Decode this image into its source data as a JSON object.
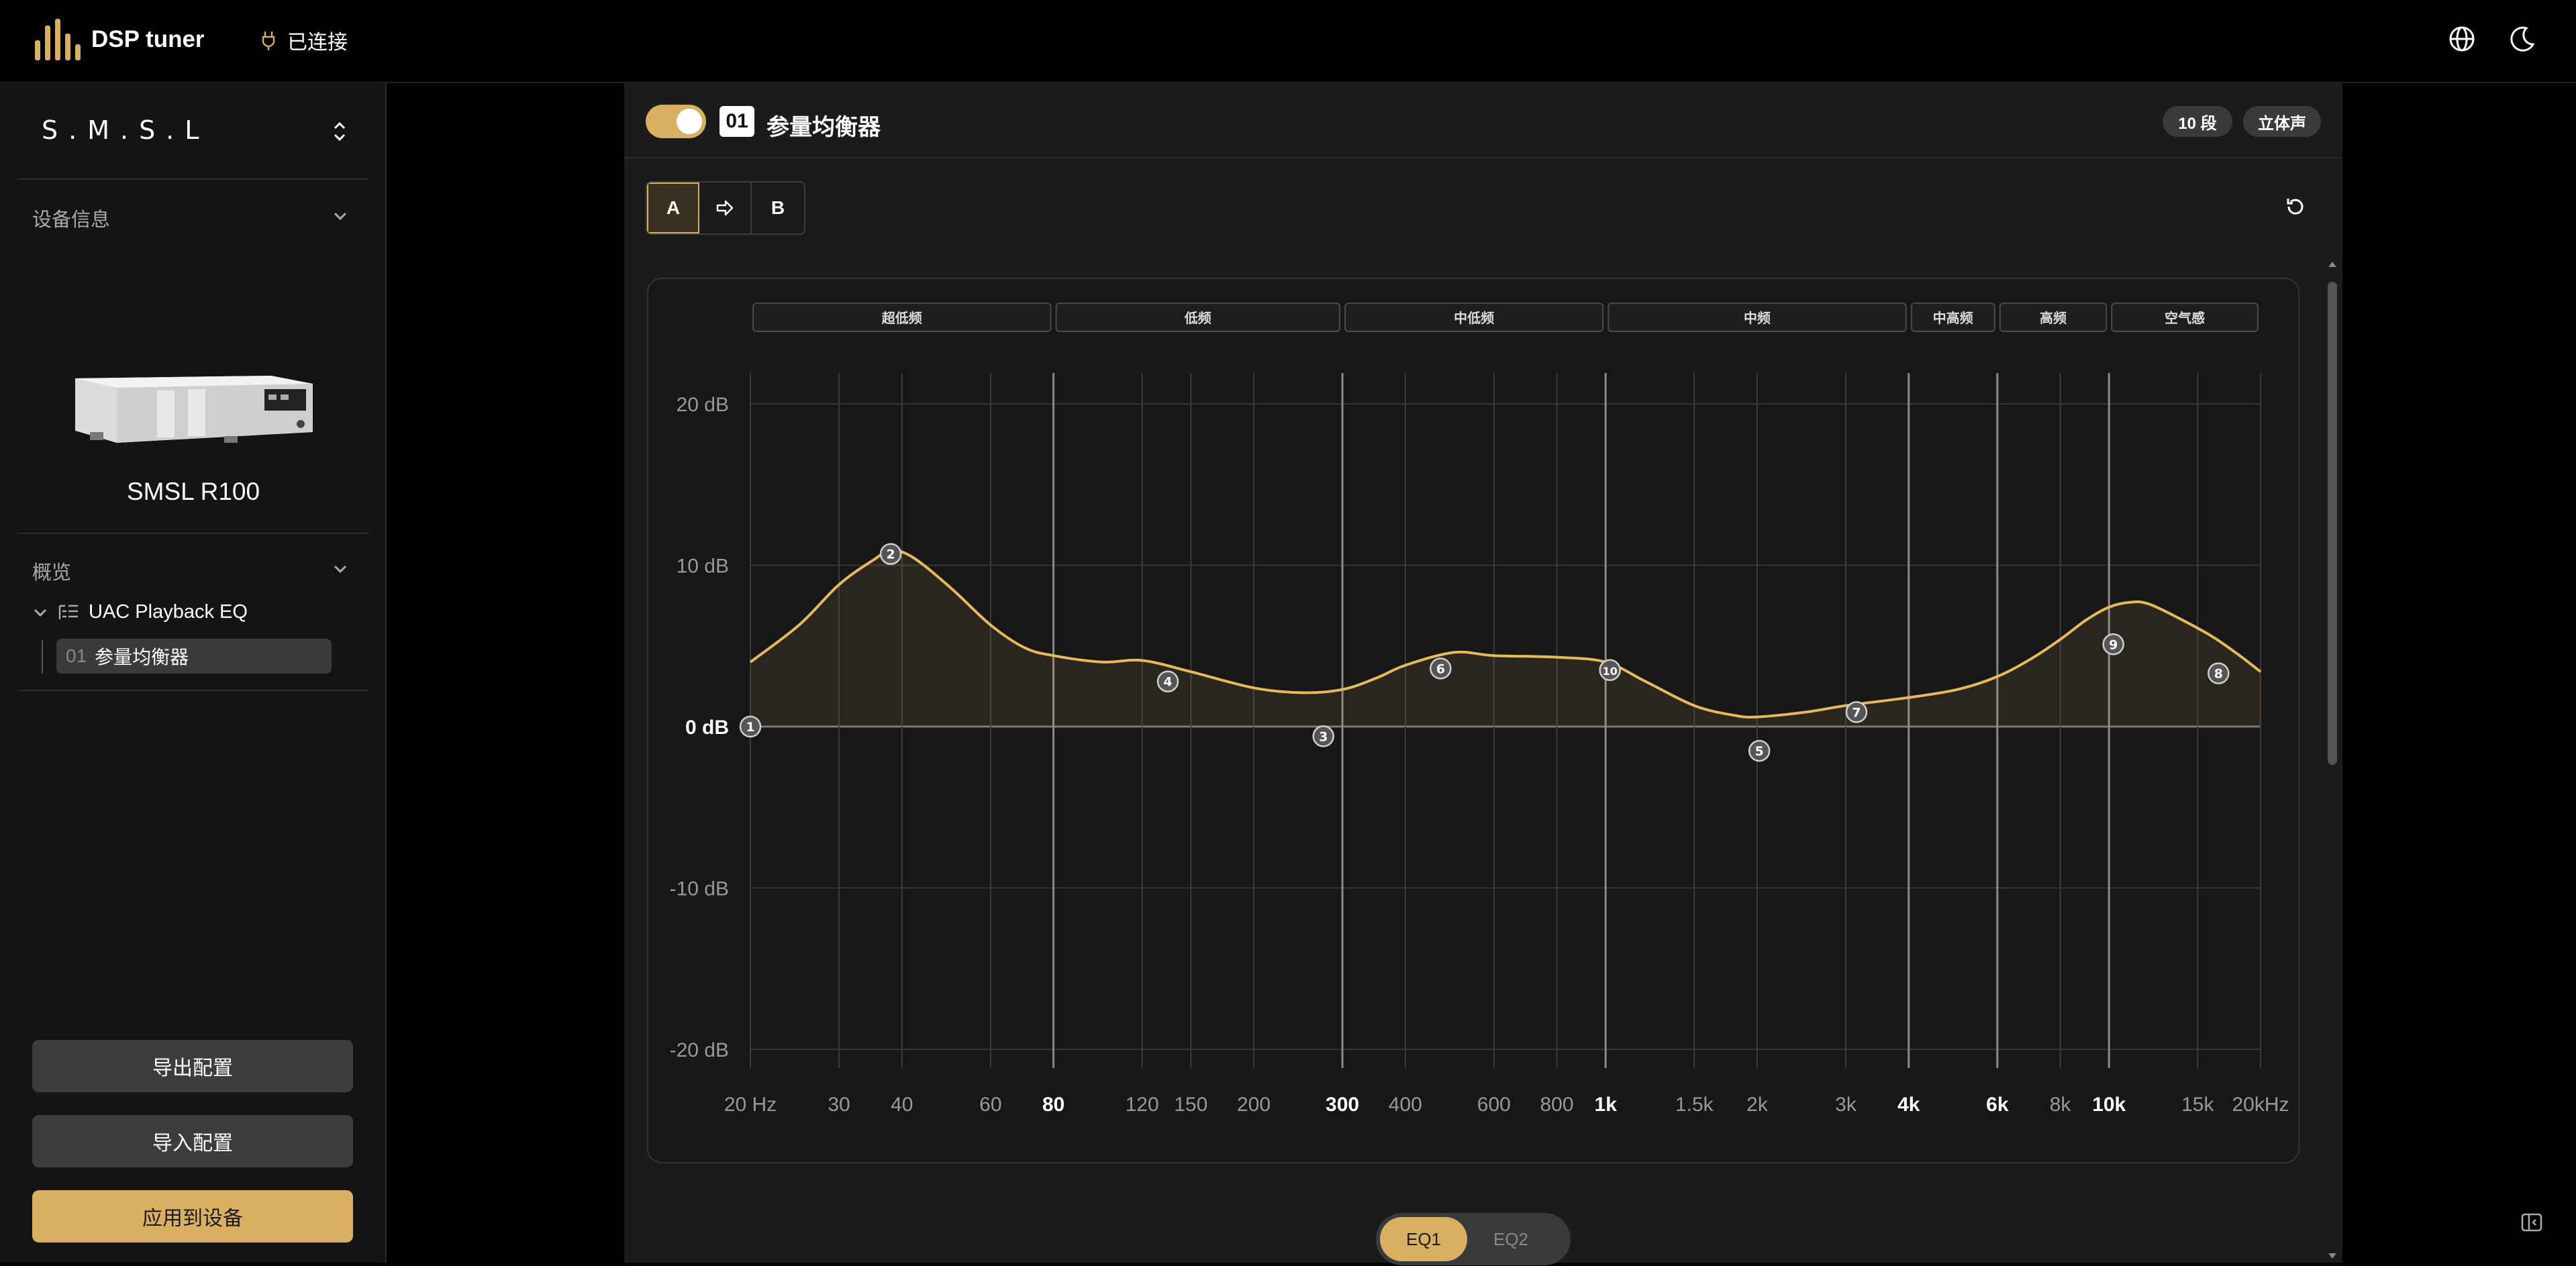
{
  "app": {
    "name": "DSP tuner",
    "status": "已连接"
  },
  "sidebar": {
    "brand": "S.M.S.L",
    "device_info_label": "设备信息",
    "device_name": "SMSL R100",
    "overview_label": "概览",
    "tree": {
      "group": "UAC Playback EQ",
      "item_num": "01",
      "item_label": "参量均衡器"
    },
    "buttons": {
      "export": "导出配置",
      "import": "导入配置",
      "apply": "应用到设备"
    }
  },
  "panel": {
    "enabled": true,
    "index": "01",
    "title": "参量均衡器",
    "bands_pill": "10 段",
    "channel_pill": "立体声",
    "ab": {
      "a": "A",
      "b": "B"
    },
    "eq_tabs": [
      "EQ1",
      "EQ2"
    ],
    "active_eq_tab": "EQ1"
  },
  "colors": {
    "accent": "#d9b062",
    "curve": "#e6b95a"
  },
  "icons": [
    "app-logo-icon",
    "plug-icon",
    "globe-icon",
    "moon-icon",
    "chevron-updown-icon",
    "chevron-down-icon",
    "list-icon",
    "arrow-right-icon",
    "reset-icon",
    "sidebar-toggle-icon"
  ],
  "chart_data": {
    "type": "line",
    "xscale": "log",
    "xlim": [
      20,
      20000
    ],
    "ylim": [
      -20,
      20
    ],
    "y_ticks": [
      {
        "v": 20,
        "label": "20 dB"
      },
      {
        "v": 10,
        "label": "10 dB"
      },
      {
        "v": 0,
        "label": "0 dB"
      },
      {
        "v": -10,
        "label": "-10 dB"
      },
      {
        "v": -20,
        "label": "-20 dB"
      }
    ],
    "x_ticks": [
      {
        "f": 20,
        "label": "20 Hz",
        "bold": false
      },
      {
        "f": 30,
        "label": "30",
        "bold": false
      },
      {
        "f": 40,
        "label": "40",
        "bold": false
      },
      {
        "f": 60,
        "label": "60",
        "bold": false
      },
      {
        "f": 80,
        "label": "80",
        "bold": true
      },
      {
        "f": 120,
        "label": "120",
        "bold": false
      },
      {
        "f": 150,
        "label": "150",
        "bold": false
      },
      {
        "f": 200,
        "label": "200",
        "bold": false
      },
      {
        "f": 300,
        "label": "300",
        "bold": true
      },
      {
        "f": 400,
        "label": "400",
        "bold": false
      },
      {
        "f": 600,
        "label": "600",
        "bold": false
      },
      {
        "f": 800,
        "label": "800",
        "bold": false
      },
      {
        "f": 1000,
        "label": "1k",
        "bold": true
      },
      {
        "f": 1500,
        "label": "1.5k",
        "bold": false
      },
      {
        "f": 2000,
        "label": "2k",
        "bold": false
      },
      {
        "f": 3000,
        "label": "3k",
        "bold": false
      },
      {
        "f": 4000,
        "label": "4k",
        "bold": true
      },
      {
        "f": 6000,
        "label": "6k",
        "bold": true
      },
      {
        "f": 8000,
        "label": "8k",
        "bold": false
      },
      {
        "f": 10000,
        "label": "10k",
        "bold": true
      },
      {
        "f": 15000,
        "label": "15k",
        "bold": false
      },
      {
        "f": 20000,
        "label": "20kHz",
        "bold": false
      }
    ],
    "regions": [
      {
        "label": "超低频",
        "from": 20,
        "to": 80
      },
      {
        "label": "低频",
        "from": 80,
        "to": 300
      },
      {
        "label": "中低频",
        "from": 300,
        "to": 1000
      },
      {
        "label": "中频",
        "from": 1000,
        "to": 4000
      },
      {
        "label": "中高频",
        "from": 4000,
        "to": 6000
      },
      {
        "label": "高频",
        "from": 6000,
        "to": 10000
      },
      {
        "label": "空气感",
        "from": 10000,
        "to": 20000
      }
    ],
    "curve": [
      [
        20,
        4
      ],
      [
        25,
        6.3
      ],
      [
        30,
        8.8
      ],
      [
        35,
        10.3
      ],
      [
        38,
        10.9
      ],
      [
        42,
        10.5
      ],
      [
        50,
        8.6
      ],
      [
        60,
        6.3
      ],
      [
        70,
        4.9
      ],
      [
        80,
        4.4
      ],
      [
        100,
        4.0
      ],
      [
        120,
        4.1
      ],
      [
        150,
        3.4
      ],
      [
        200,
        2.4
      ],
      [
        250,
        2.1
      ],
      [
        300,
        2.3
      ],
      [
        350,
        3.0
      ],
      [
        400,
        3.8
      ],
      [
        500,
        4.6
      ],
      [
        600,
        4.4
      ],
      [
        800,
        4.3
      ],
      [
        1000,
        4.0
      ],
      [
        1200,
        2.8
      ],
      [
        1500,
        1.3
      ],
      [
        1800,
        0.7
      ],
      [
        2000,
        0.6
      ],
      [
        2500,
        0.9
      ],
      [
        3000,
        1.3
      ],
      [
        4000,
        1.8
      ],
      [
        5000,
        2.3
      ],
      [
        6000,
        3.1
      ],
      [
        7000,
        4.2
      ],
      [
        8000,
        5.4
      ],
      [
        9000,
        6.6
      ],
      [
        10000,
        7.4
      ],
      [
        11000,
        7.7
      ],
      [
        12000,
        7.6
      ],
      [
        14000,
        6.6
      ],
      [
        16000,
        5.6
      ],
      [
        18000,
        4.5
      ],
      [
        20000,
        3.4
      ]
    ],
    "points": [
      {
        "n": "1",
        "f": 20,
        "g": 0
      },
      {
        "n": "2",
        "f": 38,
        "g": 10.7
      },
      {
        "n": "3",
        "f": 275,
        "g": -0.6
      },
      {
        "n": "4",
        "f": 135,
        "g": 2.8
      },
      {
        "n": "5",
        "f": 2020,
        "g": -1.5
      },
      {
        "n": "6",
        "f": 470,
        "g": 3.6
      },
      {
        "n": "7",
        "f": 3150,
        "g": 0.9
      },
      {
        "n": "8",
        "f": 16500,
        "g": 3.3
      },
      {
        "n": "9",
        "f": 10200,
        "g": 5.1
      },
      {
        "n": "10",
        "f": 1020,
        "g": 3.5
      }
    ]
  }
}
